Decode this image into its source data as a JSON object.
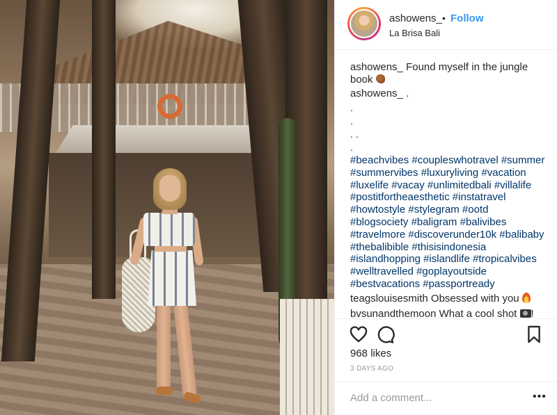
{
  "post": {
    "username": "ashowens_",
    "follow_label": "Follow",
    "location": "La Brisa Bali",
    "caption_author": "ashowens_",
    "caption_text": "Found myself in the jungle book",
    "second_author": "ashowens_",
    "second_text": ".",
    "dots": [
      ".",
      ".",
      ". .",
      "."
    ],
    "hashtags": [
      "#beachvibes",
      "#coupleswhotravel",
      "#summer",
      "#summervibes",
      "#luxuryliving",
      "#vacation",
      "#luxelife",
      "#vacay",
      "#unlimitedbali",
      "#villalife",
      "#postitfortheaesthetic",
      "#instatravel",
      "#howtostyle",
      "#stylegram",
      "#ootd",
      "#blogsociety",
      "#baligram",
      "#balivibes",
      "#travelmore",
      "#discoverunder10k",
      "#balibaby",
      "#thebalibible",
      "#thisisindonesia",
      "#islandhopping",
      "#islandlife",
      "#tropicalvibes",
      "#welltravelled",
      "#goplayoutside",
      "#bestvacations",
      "#passportready"
    ],
    "comments": [
      {
        "author": "teagslouisesmith",
        "text": "Obsessed with you",
        "emoji": "fire"
      },
      {
        "author": "bvsunandthemoon",
        "text": "What a cool shot",
        "emoji": "camera"
      }
    ],
    "likes": "968 likes",
    "date": "3 DAYS AGO",
    "add_comment_placeholder": "Add a comment...",
    "more_label": "•••"
  },
  "icons": {
    "like": "heart-icon",
    "comment": "comment-icon",
    "save": "bookmark-icon",
    "caption_emoji": "sweat-droplets-icon"
  }
}
